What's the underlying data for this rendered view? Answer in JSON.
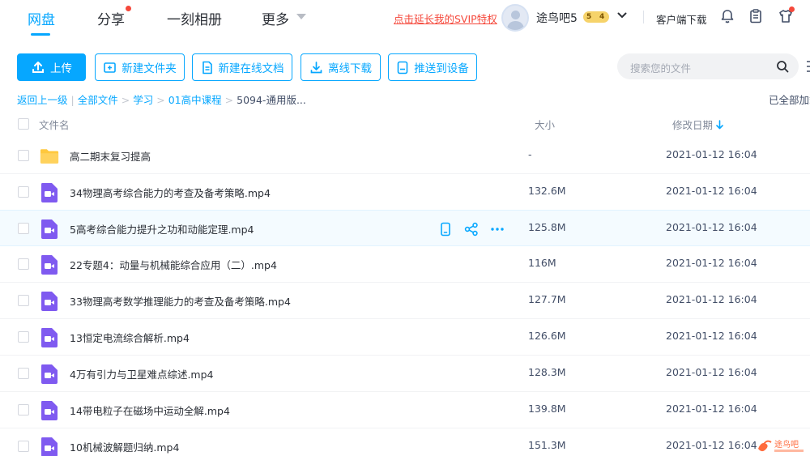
{
  "nav": {
    "tabs": [
      "网盘",
      "分享",
      "一刻相册",
      "更多"
    ],
    "svip_link": "点击延长我的SVIP特权",
    "username": "途鸟吧5",
    "level_left": "5",
    "level_right": "4",
    "client_download": "客户端下载"
  },
  "toolbar": {
    "upload": "上传",
    "new_folder": "新建文件夹",
    "new_doc": "新建在线文档",
    "offline": "离线下载",
    "push": "推送到设备",
    "search_placeholder": "搜索您的文件"
  },
  "breadcrumb": {
    "back": "返回上一级",
    "all": "全部文件",
    "c1": "学习",
    "c2": "01高中课程",
    "c3": "5094-通用版...",
    "loaded": "已全部加载"
  },
  "table": {
    "col_name": "文件名",
    "col_size": "大小",
    "col_date": "修改日期",
    "rows": [
      {
        "name": "高二期末复习提高",
        "size": "-",
        "date": "2021-01-12 16:04",
        "type": "folder"
      },
      {
        "name": "34物理高考综合能力的考查及备考策略.mp4",
        "size": "132.6M",
        "date": "2021-01-12 16:04",
        "type": "video"
      },
      {
        "name": "5高考综合能力提升之功和动能定理.mp4",
        "size": "125.8M",
        "date": "2021-01-12 16:04",
        "type": "video"
      },
      {
        "name": "22专题4：动量与机械能综合应用（二）.mp4",
        "size": "116M",
        "date": "2021-01-12 16:04",
        "type": "video"
      },
      {
        "name": "33物理高考数学推理能力的考查及备考策略.mp4",
        "size": "127.7M",
        "date": "2021-01-12 16:04",
        "type": "video"
      },
      {
        "name": "13恒定电流综合解析.mp4",
        "size": "126.6M",
        "date": "2021-01-12 16:04",
        "type": "video"
      },
      {
        "name": "4万有引力与卫星难点综述.mp4",
        "size": "128.3M",
        "date": "2021-01-12 16:04",
        "type": "video"
      },
      {
        "name": "14带电粒子在磁场中运动全解.mp4",
        "size": "139.8M",
        "date": "2021-01-12 16:04",
        "type": "video"
      },
      {
        "name": "10机械波解题归纳.mp4",
        "size": "151.3M",
        "date": "2021-01-12 16:04",
        "type": "video"
      }
    ]
  },
  "watermark": "途鸟吧",
  "colors": {
    "accent": "#06a7ff",
    "video_icon": "#7f5af0",
    "folder": "#ffc83d",
    "red": "#f5483b"
  },
  "icons": [
    "upload-icon",
    "add-folder-icon",
    "document-icon",
    "download-icon",
    "device-icon",
    "search-icon",
    "bell-icon",
    "clipboard-icon",
    "shirt-icon",
    "phone-icon",
    "share-icon",
    "more-icon",
    "folder-icon",
    "video-file-icon"
  ]
}
